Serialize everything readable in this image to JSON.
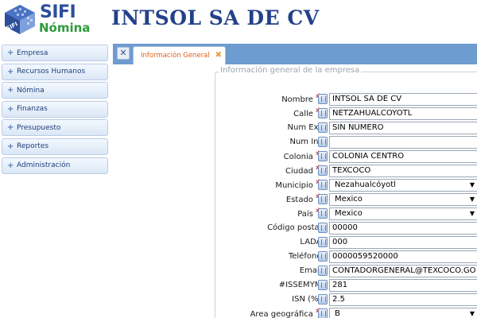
{
  "header": {
    "logo_text_main": "SIFI",
    "logo_text_sub": "Nómina",
    "logo_cube_text": "SIFI",
    "company_name": "INTSOL SA DE CV"
  },
  "sidebar": {
    "items": [
      {
        "label": "Empresa"
      },
      {
        "label": "Recursos Humanos"
      },
      {
        "label": "Nómina"
      },
      {
        "label": "Finanzas"
      },
      {
        "label": "Presupuesto"
      },
      {
        "label": "Reportes"
      },
      {
        "label": "Administración"
      }
    ]
  },
  "tabs": {
    "active_label": "Información General"
  },
  "form": {
    "legend": "Información general de la empresa",
    "fields": [
      {
        "label": "Nombre",
        "required": "*",
        "value": "INTSOL SA DE CV",
        "type": "text"
      },
      {
        "label": "Calle",
        "required": "*",
        "value": "NETZAHUALCOYOTL",
        "type": "text"
      },
      {
        "label": "Num Ext",
        "required": "",
        "value": "SIN NUMERO",
        "type": "text"
      },
      {
        "label": "Num Int",
        "required": "",
        "value": "",
        "type": "text"
      },
      {
        "label": "Colonia",
        "required": "*",
        "value": "COLONIA CENTRO",
        "type": "text"
      },
      {
        "label": "Ciudad",
        "required": "*",
        "value": "TEXCOCO",
        "type": "text"
      },
      {
        "label": "Municipio",
        "required": "*",
        "value": "Nezahualcóyotl",
        "type": "select"
      },
      {
        "label": "Estado",
        "required": "*",
        "value": "Mexico",
        "type": "select"
      },
      {
        "label": "País",
        "required": "*",
        "value": "Mexico",
        "type": "select"
      },
      {
        "label": "Código postal",
        "required": "",
        "value": "00000",
        "type": "text"
      },
      {
        "label": "LADA",
        "required": "",
        "value": "000",
        "type": "text"
      },
      {
        "label": "Teléfono",
        "required": "",
        "value": "0000059520000",
        "type": "text"
      },
      {
        "label": "Email",
        "required": "",
        "value": "CONTADORGENERAL@TEXCOCO.GO",
        "type": "text"
      },
      {
        "label": "#ISSEMYM",
        "required": "",
        "value": "281",
        "type": "text"
      },
      {
        "label": "ISN (%)",
        "required": "",
        "value": "2.5",
        "type": "text"
      },
      {
        "label": "Area geográfica",
        "required": "*",
        "value": "B",
        "type": "select"
      }
    ]
  },
  "colors": {
    "title_blue": "#23418a",
    "tabbar_blue": "#6e9bd0",
    "tab_label_orange": "#e0621a",
    "required_red": "#e02020",
    "logo_green": "#2e9a3c"
  },
  "icons": {
    "logo": "sifi-cube-logo-icon",
    "sidebar_expand": "plus-icon",
    "tab_close_all": "close-icon",
    "tab_close": "close-icon",
    "field_info": "info-icon",
    "select_arrow": "chevron-down-icon"
  }
}
